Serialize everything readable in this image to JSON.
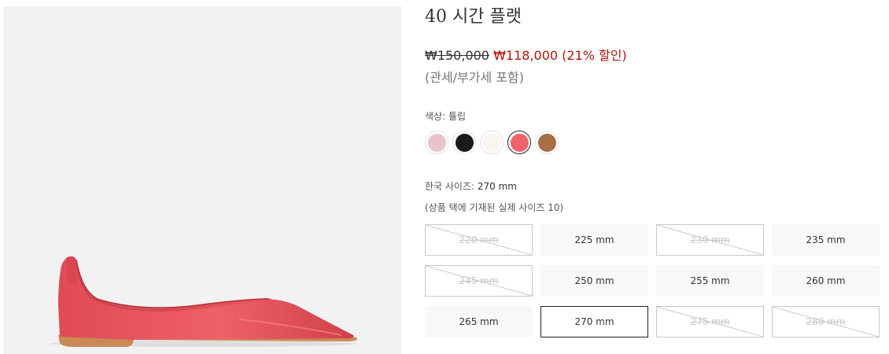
{
  "product": {
    "title": "40 시간 플랫",
    "price_original": "₩150,000",
    "price_sale": "₩118,000",
    "price_discount": "(21% 할인)",
    "tax_note": "(관세/부가세 포함)"
  },
  "color": {
    "label": "색상:",
    "selected_name": "튤립",
    "swatches": [
      {
        "name": "pink",
        "hex": "#e8c3c8",
        "selected": false
      },
      {
        "name": "black",
        "hex": "#1a1a1a",
        "selected": false
      },
      {
        "name": "cream",
        "hex": "#faf6ee",
        "selected": false
      },
      {
        "name": "tulip",
        "hex": "#f0636a",
        "selected": true
      },
      {
        "name": "tan",
        "hex": "#a86e44",
        "selected": false
      }
    ]
  },
  "size": {
    "label": "한국 사이즈:",
    "selected_value": "270 mm",
    "note": "(상품 택에 기재된 실제 사이즈 10)",
    "options": [
      {
        "label": "220 mm",
        "available": false,
        "selected": false
      },
      {
        "label": "225 mm",
        "available": true,
        "selected": false
      },
      {
        "label": "230 mm",
        "available": false,
        "selected": false
      },
      {
        "label": "235 mm",
        "available": true,
        "selected": false
      },
      {
        "label": "245 mm",
        "available": false,
        "selected": false
      },
      {
        "label": "250 mm",
        "available": true,
        "selected": false
      },
      {
        "label": "255 mm",
        "available": true,
        "selected": false
      },
      {
        "label": "260 mm",
        "available": true,
        "selected": false
      },
      {
        "label": "265 mm",
        "available": true,
        "selected": false
      },
      {
        "label": "270 mm",
        "available": true,
        "selected": true
      },
      {
        "label": "275 mm",
        "available": false,
        "selected": false
      },
      {
        "label": "280 mm",
        "available": false,
        "selected": false
      }
    ]
  },
  "colors": {
    "sale_red": "#b2150a",
    "shoe_upper": "#e8555e",
    "shoe_sole": "#c98a56",
    "image_bg": "#f2f2f2"
  }
}
